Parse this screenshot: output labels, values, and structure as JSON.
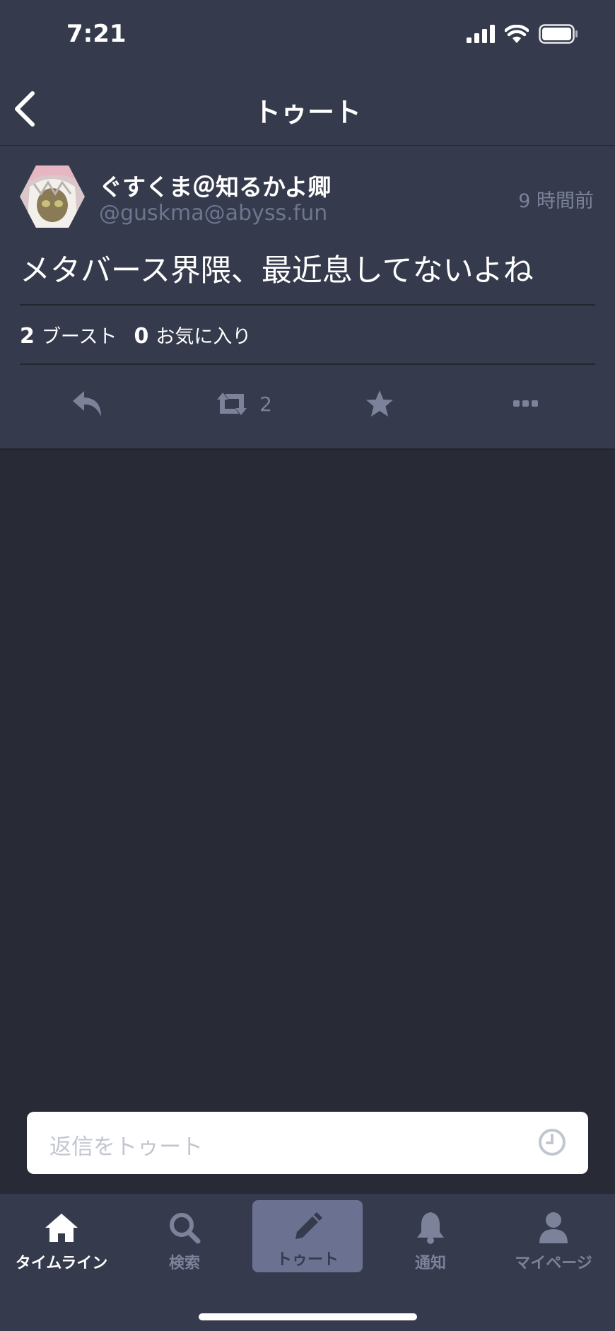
{
  "status_bar": {
    "time": "7:21"
  },
  "nav": {
    "title": "トゥート"
  },
  "post": {
    "display_name": "ぐすくま＠知るかよ卿",
    "handle": "@guskma@abyss.fun",
    "timestamp": "9 時間前",
    "content": "メタバース界隈、最近息してないよね",
    "boost_count": "2",
    "boost_label": "ブースト",
    "fav_count": "0",
    "fav_label": "お気に入り",
    "actions": {
      "reblog_count": "2"
    }
  },
  "reply": {
    "placeholder": "返信をトゥート"
  },
  "tabbar": {
    "tabs": [
      {
        "label": "タイムライン",
        "icon": "home-icon"
      },
      {
        "label": "検索",
        "icon": "search-icon"
      },
      {
        "label": "トゥート",
        "icon": "pencil-icon"
      },
      {
        "label": "通知",
        "icon": "bell-icon"
      },
      {
        "label": "マイページ",
        "icon": "user-icon"
      }
    ]
  },
  "colors": {
    "background": "#282a36",
    "panel": "#353a4c",
    "muted": "#7b8299",
    "accent": "#6b7291"
  }
}
